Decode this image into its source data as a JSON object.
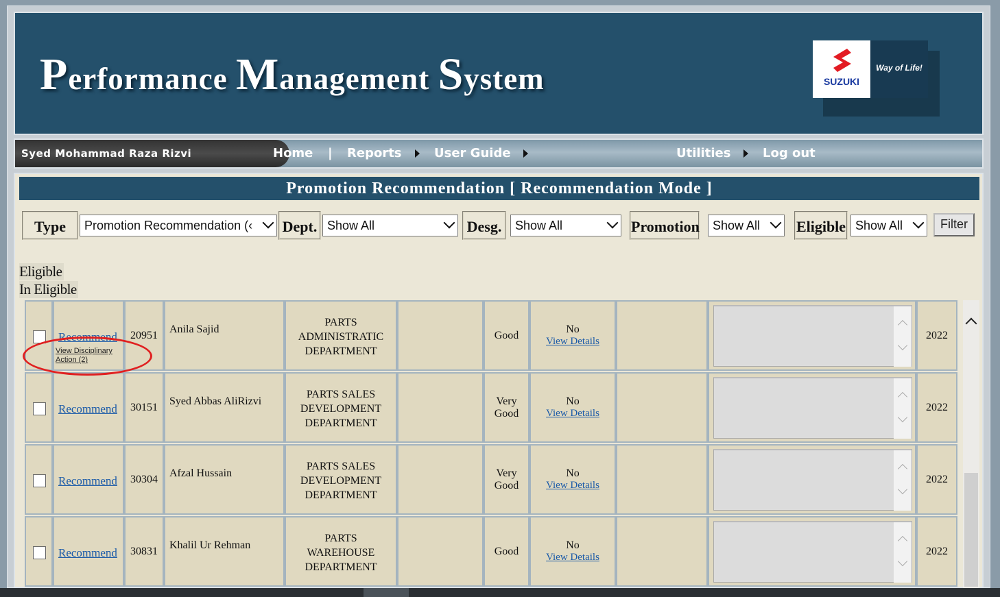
{
  "header": {
    "title_parts": [
      {
        "cap": "P",
        "rest": "erformance "
      },
      {
        "cap": "M",
        "rest": "anagement "
      },
      {
        "cap": "S",
        "rest": "ystem"
      }
    ],
    "logo_brand": "SUZUKI",
    "logo_slogan": "Way of Life!",
    "brand_color": "#24506b"
  },
  "nav": {
    "user_name": "Syed Mohammad Raza Rizvi",
    "home": "Home",
    "separator": "|",
    "reports": "Reports",
    "user_guide": "User Guide",
    "utilities": "Utilities",
    "logout": "Log out"
  },
  "page": {
    "title": "Promotion Recommendation [ Recommendation Mode ]"
  },
  "filters": {
    "type_label": "Type",
    "type_value": "Promotion Recommendation (‹",
    "dept_label": "Dept.",
    "dept_value": "Show All",
    "desg_label": "Desg.",
    "desg_value": "Show All",
    "promotion_label": "Promotion",
    "promotion_value": "Show All",
    "eligible_label": "Eligible",
    "eligible_value": "Show All",
    "filter_button": "Filter"
  },
  "legend": {
    "eligible": "Eligible",
    "in_eligible": "In Eligible"
  },
  "rows": [
    {
      "recommend": "Recommend",
      "disciplinary": "View Disciplinary Action (2)",
      "id": "20951",
      "name": "Anila Sajid",
      "dept": [
        "PARTS",
        "ADMINISTRATIC",
        "DEPARTMENT"
      ],
      "rating": [
        "Good"
      ],
      "promoted": "No",
      "details": "View Details",
      "year": "2022"
    },
    {
      "recommend": "Recommend",
      "disciplinary": "",
      "id": "30151",
      "name": "Syed Abbas AliRizvi",
      "dept": [
        "PARTS SALES",
        "DEVELOPMENT",
        "DEPARTMENT"
      ],
      "rating": [
        "Very",
        "Good"
      ],
      "promoted": "No",
      "details": "View Details",
      "year": "2022"
    },
    {
      "recommend": "Recommend",
      "disciplinary": "",
      "id": "30304",
      "name": "Afzal Hussain",
      "dept": [
        "PARTS SALES",
        "DEVELOPMENT",
        "DEPARTMENT"
      ],
      "rating": [
        "Very",
        "Good"
      ],
      "promoted": "No",
      "details": "View Details",
      "year": "2022"
    },
    {
      "recommend": "Recommend",
      "disciplinary": "",
      "id": "30831",
      "name": "Khalil Ur Rehman",
      "dept": [
        "PARTS",
        "WAREHOUSE",
        "DEPARTMENT"
      ],
      "rating": [
        "Good"
      ],
      "promoted": "No",
      "details": "View Details",
      "year": "2022"
    }
  ]
}
